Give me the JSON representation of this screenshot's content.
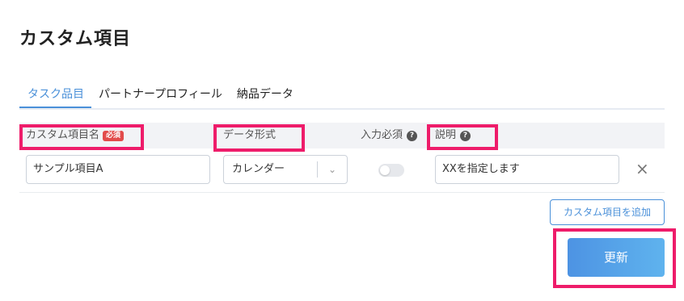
{
  "title": "カスタム項目",
  "tabs": [
    {
      "label": "タスク品目",
      "active": true
    },
    {
      "label": "パートナープロフィール",
      "active": false
    },
    {
      "label": "納品データ",
      "active": false
    }
  ],
  "table": {
    "headers": {
      "name": "カスタム項目名",
      "required_badge": "必須",
      "format": "データ形式",
      "input_required": "入力必須",
      "description": "説明"
    },
    "rows": [
      {
        "name": "サンプル項目A",
        "format": "カレンダー",
        "input_required": false,
        "description": "XXを指定します"
      }
    ]
  },
  "buttons": {
    "add_item": "カスタム項目を追加",
    "update": "更新"
  },
  "icons": {
    "help": "?",
    "close": "×",
    "chevron": "⌄"
  },
  "colors": {
    "accent": "#4a90d9",
    "required_badge": "#e24b4b",
    "highlight": "#ee1c6a"
  }
}
